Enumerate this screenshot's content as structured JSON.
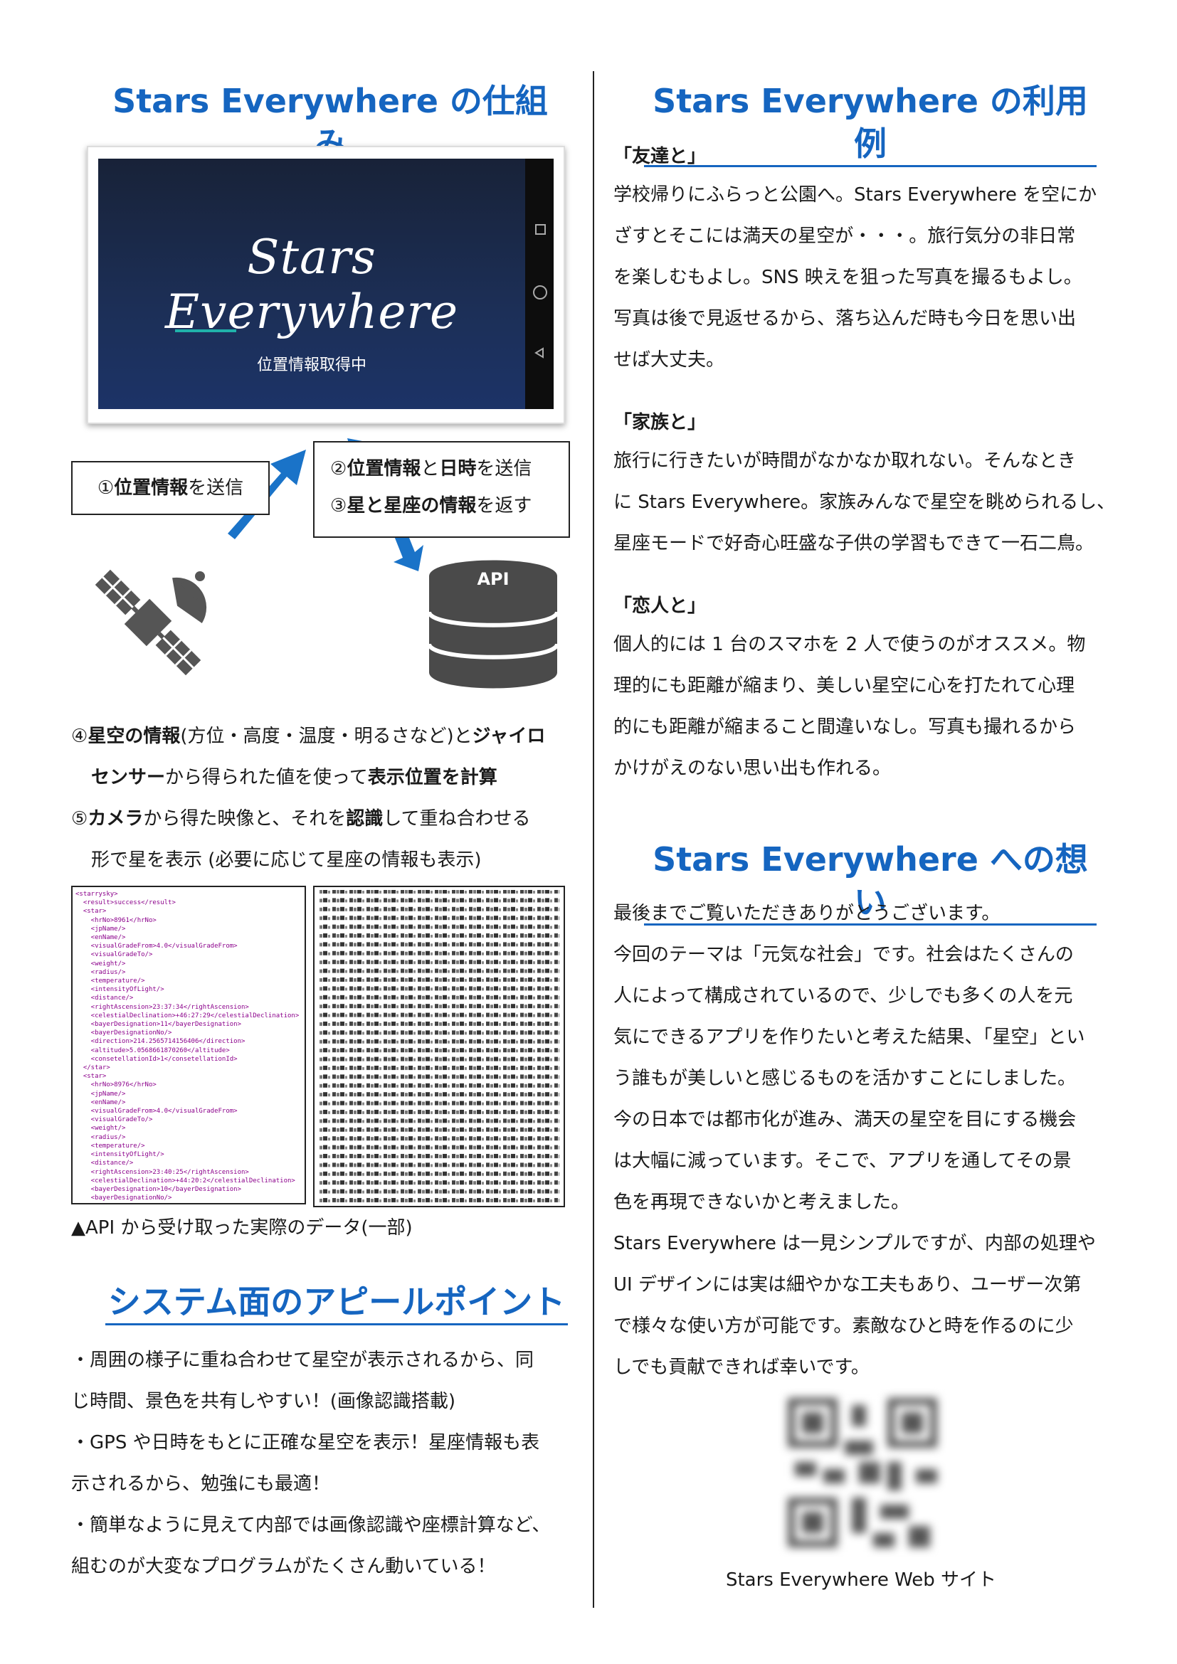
{
  "left": {
    "heading": "Stars Everywhere の仕組み",
    "phone": {
      "logo": "Stars Everywhere",
      "status": "位置情報取得中"
    },
    "step1": {
      "num": "①",
      "bold": "位置情報",
      "rest": "を送信"
    },
    "step2": {
      "num": "②",
      "bold1": "位置情報",
      "mid": "と",
      "bold2": "日時",
      "rest": "を送信"
    },
    "step3": {
      "num": "③",
      "bold": "星と星座の情報",
      "rest": "を返す"
    },
    "api_label": "API",
    "step4": {
      "num": "④",
      "bold1": "星空の情報",
      "mid1": "(方位・高度・温度・明るさなど)と",
      "bold2": "ジャイロ",
      "bold3": "センサー",
      "mid2": "から得られた値を使って",
      "bold4": "表示位置を計算"
    },
    "step5": {
      "num": "⑤",
      "bold1": "カメラ",
      "mid1": "から得た映像と、それを",
      "bold2": "認識",
      "mid2": "して重ね合わせる",
      "line2": "形で星を表示 (必要に応じて星座の情報も表示)"
    },
    "caption": "▲API から受け取った実際のデータ(一部)",
    "xml_lines": [
      "<starrysky>",
      "  <result>success</result>",
      "  <star>",
      "    <hrNo>8961</hrNo>",
      "    <jpName/>",
      "    <enName/>",
      "    <visualGradeFrom>4.0</visualGradeFrom>",
      "    <visualGradeTo/>",
      "    <weight/>",
      "    <radius/>",
      "    <temperature/>",
      "    <intensityOfLight/>",
      "    <distance/>",
      "    <rightAscension>23:37:34</rightAscension>",
      "    <celestialDeclination>+46:27:29</celestialDeclination>",
      "    <bayerDesignation>11</bayerDesignation>",
      "    <bayerDesignationNo/>",
      "    <direction>214.2565714156406</direction>",
      "    <altitude>5.0568661870260</altitude>",
      "    <consetellationId>1</consetellationId>",
      "  </star>",
      "  <star>",
      "    <hrNo>8976</hrNo>",
      "    <jpName/>",
      "    <enName/>",
      "    <visualGradeFrom>4.0</visualGradeFrom>",
      "    <visualGradeTo/>",
      "    <weight/>",
      "    <radius/>",
      "    <temperature/>",
      "    <intensityOfLight/>",
      "    <distance/>",
      "    <rightAscension>23:40:25</rightAscension>",
      "    <celestialDeclination>+44:20:2</celestialDeclination>",
      "    <bayerDesignation>10</bayerDesignation>",
      "    <bayerDesignationNo/>",
      "    <direction>215.3035375767 49</direction>",
      "    <altitude>3.2043487753760 63</altitude>",
      "    <consetellationId>1</consetellationId>",
      "  </star>"
    ],
    "system_heading": "システム面のアピールポイント",
    "system_lines": [
      "・周囲の様子に重ね合わせて星空が表示されるから、同",
      "じ時間、景色を共有しやすい！(画像認識搭載)",
      "・GPS や日時をもとに正確な星空を表示！星座情報も表",
      "示されるから、勉強にも最適！",
      "・簡単なように見えて内部では画像認識や座標計算など、",
      "組むのが大変なプログラムがたくさん動いている！"
    ]
  },
  "right": {
    "heading": "Stars Everywhere の利用例",
    "examples": [
      {
        "title": "「友達と」",
        "lines": [
          "学校帰りにふらっと公園へ。Stars Everywhere を空にか",
          "ざすとそこには満天の星空が・・・。旅行気分の非日常",
          "を楽しむもよし。SNS  映えを狙った写真を撮るもよし。",
          "写真は後で見返せるから、落ち込んだ時も今日を思い出",
          "せば大丈夫。"
        ]
      },
      {
        "title": "「家族と」",
        "lines": [
          "旅行に行きたいが時間がなかなか取れない。そんなとき",
          "に Stars Everywhere。家族みんなで星空を眺められるし、",
          "星座モードで好奇心旺盛な子供の学習もできて一石二鳥。"
        ]
      },
      {
        "title": "「恋人と」",
        "lines": [
          "個人的には 1 台のスマホを 2 人で使うのがオススメ。物",
          "理的にも距離が縮まり、美しい星空に心を打たれて心理",
          "的にも距離が縮まること間違いなし。写真も撮れるから",
          "かけがえのない思い出も作れる。"
        ]
      }
    ],
    "thoughts_heading": "Stars Everywhere への想い",
    "thoughts_lines": [
      "最後までご覧いただきありがとうございます。",
      "今回のテーマは「元気な社会」です。社会はたくさんの",
      "人によって構成されているので、少しでも多くの人を元",
      "気にできるアプリを作りたいと考えた結果、「星空」とい",
      "う誰もが美しいと感じるものを活かすことにしました。",
      "今の日本では都市化が進み、満天の星空を目にする機会",
      "は大幅に減っています。そこで、アプリを通してその景",
      "色を再現できないかと考えました。",
      "Stars Everywhere は一見シンプルですが、内部の処理や",
      "UI デザインには実は細やかな工夫もあり、ユーザー次第",
      "で様々な使い方が可能です。素敵なひと時を作るのに少",
      "しでも貢献できれば幸いです。"
    ],
    "qr_caption": "Stars Everywhere Web サイト"
  },
  "colors": {
    "heading": "#1565c0",
    "arrow": "#1a73c8",
    "phone_bg": "#1b2a4a",
    "accent_line": "#20b2aa"
  },
  "icons": [
    "satellite-icon",
    "database-icon",
    "arrow-icon",
    "qr-code"
  ]
}
